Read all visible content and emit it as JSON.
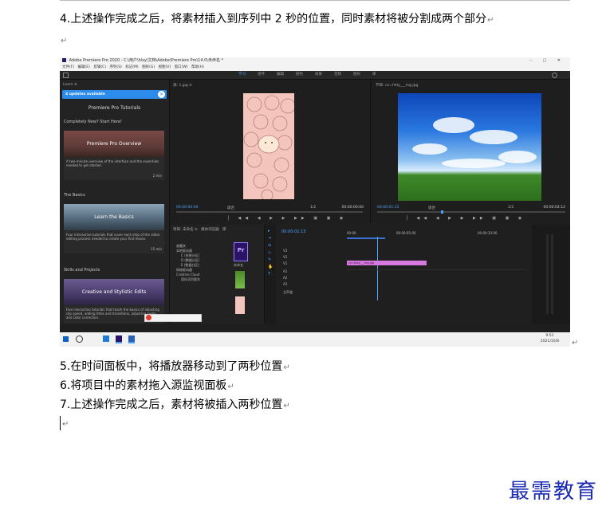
{
  "doc": {
    "step4": "4.上述操作完成之后，将素材插入到序列中 2 秒的位置，同时素材将被分割成两个部分",
    "step5": "5.在时间面板中，将播放器移动到了两秒位置",
    "step6": "6.将项目中的素材拖入源监视面板",
    "step7": "7.上述操作完成之后，素材将被插入两秒位置",
    "brand": "最需教育",
    "para_mark": "↵"
  },
  "screenshot": {
    "title": "Adobe Premiere Pro 2020 - C:\\用户\\hlsy\\文档\\Adobe\\Premiere Pro\\14.0\\未命名 *",
    "menu": [
      "文件(F)",
      "编辑(E)",
      "剪辑(C)",
      "序列(S)",
      "标记(M)",
      "图形(G)",
      "视图(V)",
      "窗口(W)",
      "帮助(H)"
    ],
    "workspaces": [
      "学习",
      "组件",
      "编辑",
      "颜色",
      "效果",
      "音频",
      "图形",
      "库"
    ],
    "learn": {
      "header": "Learn ≡",
      "updates": "4 updates available",
      "tutorials_title": "Premiere Pro Tutorials",
      "section1": "Completely New? Start Here!",
      "card1_title": "Premiere Pro Overview",
      "card1_desc": "A two-minute overview of the interface and the essentials needed to get started.",
      "card1_time": "2 min",
      "section2": "The Basics",
      "card2_title": "Learn the Basics",
      "card2_desc": "Four interactive tutorials that cover each step of the video editing process needed to create your first movie.",
      "card2_time": "15 min",
      "section3": "Skills and Projects",
      "card3_title": "Creative and Stylistic Edits",
      "card3_desc": "Five interactive tutorials that teach the basics of adjusting clip speed, adding titles and transitions, adjusting audio, and color correction."
    },
    "source": {
      "tab": "源: 1.jpg ≡",
      "timecode_in": "00:00:00:00",
      "fit": "适合",
      "scale": "1/2",
      "timecode_out": "00:00:00:00"
    },
    "program": {
      "tab": "节目: cn=hkty___mg.jpg",
      "timecode_in": "00:00:01:15",
      "fit": "适合",
      "scale": "1/2",
      "timecode_out": "00:00:04:12"
    },
    "project": {
      "tab": "项目: 未命名 ≡",
      "tab2": "媒体浏览器",
      "tab3": "库",
      "items": [
        "收藏夹",
        "本地驱动器",
        "C (系统分区)",
        "D (数据分区)",
        "E (数据分区)",
        "网络驱动器",
        "Creative Cloud",
        "团队项目版本"
      ],
      "pr_caption": "未命名"
    },
    "timeline": {
      "timecode": "00:00:01:15",
      "ruler": [
        "00:00",
        "00:00:05:00",
        "00:00:10:00"
      ],
      "tracks": [
        "V3",
        "V2",
        "V1",
        "A1",
        "A2",
        "A3"
      ],
      "master": "主声道",
      "clip_label": "cn=hkty___mg.jpg"
    },
    "taskbar": {
      "time": "9:51",
      "date": "2021/10/8"
    }
  }
}
